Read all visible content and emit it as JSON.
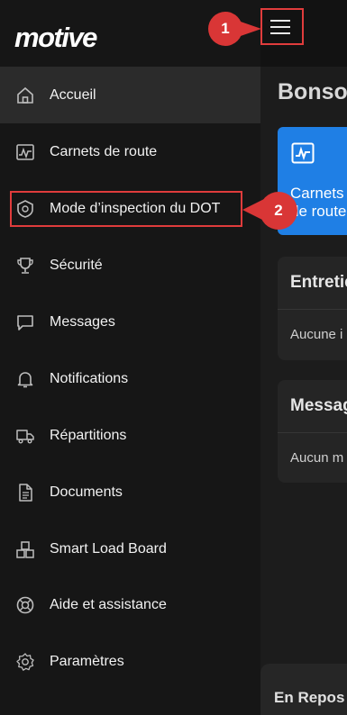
{
  "logo": "motive",
  "nav": {
    "items": [
      {
        "label": "Accueil",
        "icon": "home-icon"
      },
      {
        "label": "Carnets de route",
        "icon": "logbook-icon"
      },
      {
        "label": "Mode d’inspection du DOT",
        "icon": "inspection-badge-icon"
      },
      {
        "label": "Sécurité",
        "icon": "trophy-icon"
      },
      {
        "label": "Messages",
        "icon": "chat-icon"
      },
      {
        "label": "Notifications",
        "icon": "bell-icon"
      },
      {
        "label": "Répartitions",
        "icon": "truck-icon"
      },
      {
        "label": "Documents",
        "icon": "document-icon"
      },
      {
        "label": "Smart Load Board",
        "icon": "load-board-icon"
      },
      {
        "label": "Aide et assistance",
        "icon": "lifebuoy-icon"
      },
      {
        "label": "Paramètres",
        "icon": "gear-icon"
      }
    ]
  },
  "main": {
    "greeting": "Bonsoi",
    "logbook_card": "Carnets de route",
    "maintenance": {
      "title": "Entretie",
      "body": "Aucune i"
    },
    "messages": {
      "title": "Messag",
      "body": "Aucun m"
    },
    "status": "En Repos"
  },
  "annotations": {
    "step1": "1",
    "step2": "2"
  },
  "colors": {
    "accent_blue": "#1f7fe5",
    "annotation_red": "#d93636"
  }
}
